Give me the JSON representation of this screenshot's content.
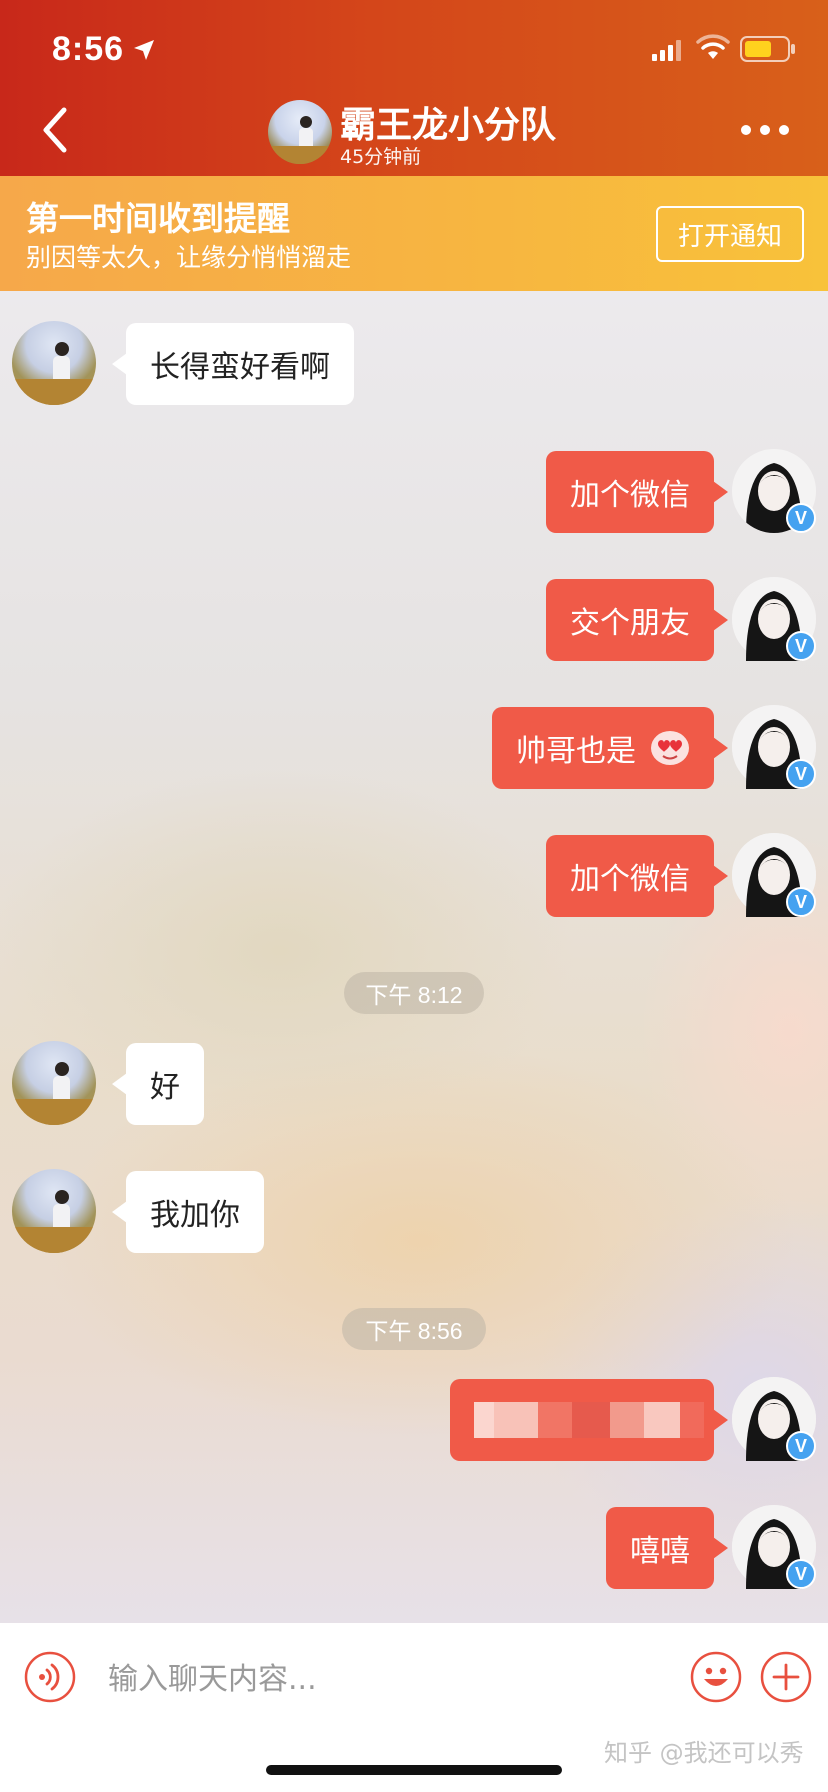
{
  "status_bar": {
    "time": "8:56"
  },
  "header": {
    "name": "霸王龙小分队",
    "subtitle": "45分钟前"
  },
  "banner": {
    "title": "第一时间收到提醒",
    "subtitle": "别因等太久，让缘分悄悄溜走",
    "button_label": "打开通知"
  },
  "messages": [
    {
      "side": "left",
      "text": "长得蛮好看啊"
    },
    {
      "side": "right",
      "text": "加个微信"
    },
    {
      "side": "right",
      "text": "交个朋友"
    },
    {
      "side": "right",
      "text": "帅哥也是",
      "emoji": "heart-eyes-emoji"
    },
    {
      "side": "right",
      "text": "加个微信"
    },
    {
      "side": "time",
      "text": "下午 8:12"
    },
    {
      "side": "left",
      "text": "好"
    },
    {
      "side": "left",
      "text": "我加你"
    },
    {
      "side": "time",
      "text": "下午 8:56"
    },
    {
      "side": "right",
      "text": "",
      "blurred": true
    },
    {
      "side": "right",
      "text": "嘻嘻"
    }
  ],
  "verify_badge": "V",
  "input": {
    "placeholder": "输入聊天内容..."
  },
  "watermark": "知乎 @我还可以秀",
  "colors": {
    "header": "#d4461a",
    "banner": "#f7b640",
    "bubble_out": "#f05a48",
    "bubble_in": "#ffffff",
    "verify": "#45a2f0"
  },
  "icons": [
    "location-arrow-icon",
    "signal-icon",
    "wifi-icon",
    "battery-icon",
    "back-arrow-icon",
    "more-dots-icon",
    "voice-icon",
    "emoji-icon",
    "plus-icon"
  ]
}
